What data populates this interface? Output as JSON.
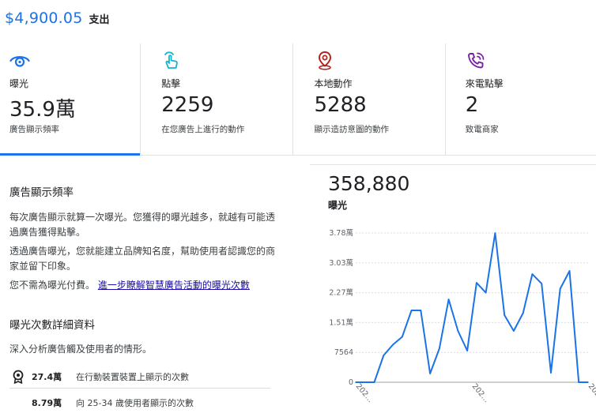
{
  "spend": {
    "amount": "$4,900.05",
    "label": "支出"
  },
  "metrics": [
    {
      "icon": "eye-icon",
      "color": "#1a73e8",
      "label": "曝光",
      "value": "35.9萬",
      "desc": "廣告顯示頻率",
      "selected": true
    },
    {
      "icon": "click-icon",
      "color": "#12b5cb",
      "label": "點擊",
      "value": "2259",
      "desc": "在您廣告上進行的動作",
      "selected": false
    },
    {
      "icon": "location-pin-icon",
      "color": "#b3261e",
      "label": "本地動作",
      "value": "5288",
      "desc": "顯示造訪意圖的動作",
      "selected": false
    },
    {
      "icon": "phone-ringing-icon",
      "color": "#7b1fa2",
      "label": "來電點擊",
      "value": "2",
      "desc": "致電商家",
      "selected": false
    }
  ],
  "info": {
    "title": "廣告顯示頻率",
    "p1": "每次廣告顯示就算一次曝光。您獲得的曝光越多，就越有可能透過廣告獲得點擊。",
    "p2": "透過廣告曝光，您就能建立品牌知名度，幫助使用者認識您的商家並留下印象。",
    "p3_prefix": "您不需為曝光付費。",
    "p3_link": "進一步瞭解智慧廣告活動的曝光次數"
  },
  "details": {
    "title": "曝光次數詳細資料",
    "subtitle": "深入分析廣告觸及使用者的情形。",
    "rows": [
      {
        "value": "27.4萬",
        "label": "在行動裝置裝置上顯示的次數"
      },
      {
        "value": "8.79萬",
        "label": "向 25-34 歲使用者顯示的次數"
      }
    ]
  },
  "summary": {
    "total": "358,880",
    "label": "曝光"
  },
  "chart_data": {
    "type": "line",
    "color": "#1a73e8",
    "y_ticks": [
      "0",
      "7564",
      "1.51萬",
      "2.27萬",
      "3.03萬",
      "3.78萬"
    ],
    "ylim": [
      0,
      37820
    ],
    "x_ticks": [
      "202…",
      "202…",
      "202…"
    ],
    "grid": true,
    "values": [
      0,
      0,
      0,
      6800,
      9500,
      11500,
      18200,
      18200,
      2200,
      8500,
      21000,
      13000,
      8000,
      25200,
      22700,
      37800,
      17000,
      13000,
      17500,
      27400,
      25000,
      2400,
      23700,
      28200,
      0,
      0
    ]
  }
}
